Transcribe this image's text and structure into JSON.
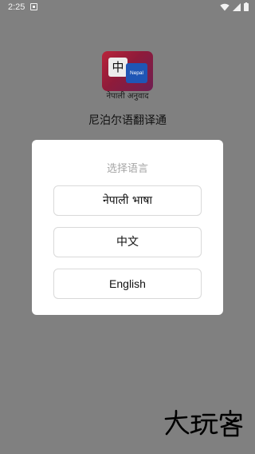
{
  "status_bar": {
    "time": "2:25",
    "icons": [
      "notification-icon",
      "wifi-icon",
      "signal-icon",
      "battery-icon"
    ]
  },
  "app": {
    "logo_badge_zh": "中",
    "logo_badge_nepal": "Nepal",
    "logo_caption": "नेपाली अनुवाद",
    "title": "尼泊尔语翻译通"
  },
  "dialog": {
    "title": "选择语言",
    "options": [
      {
        "label": "नेपाली भाषा"
      },
      {
        "label": "中文"
      },
      {
        "label": "English"
      }
    ]
  },
  "watermark": {
    "text": "大玩客"
  },
  "colors": {
    "background": "#808080",
    "dialog": "#ffffff",
    "dialog_title": "#a6a6a6",
    "logo_red": "#b8243a",
    "logo_blue": "#1f56b5"
  }
}
